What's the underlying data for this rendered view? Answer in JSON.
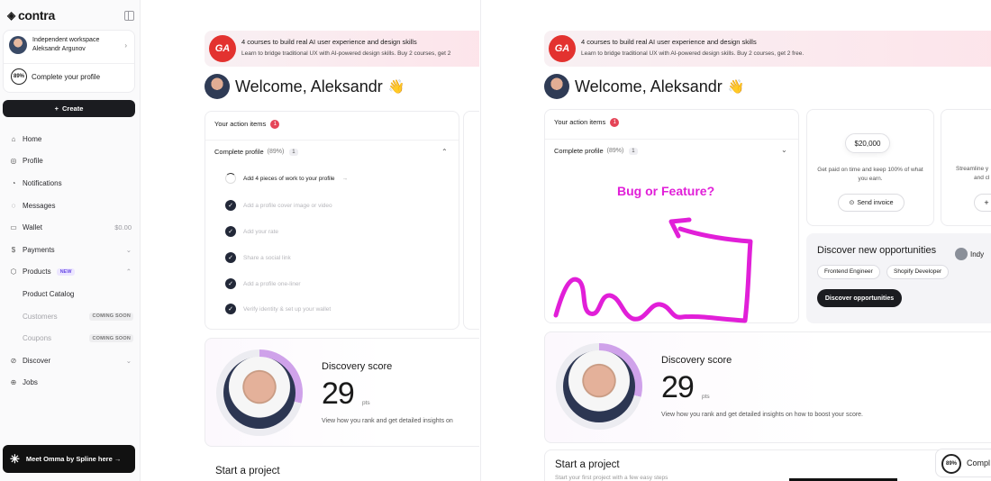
{
  "sidebar": {
    "logo": "contra",
    "workspace": {
      "title": "Independent workspace",
      "user": "Aleksandr Argunov"
    },
    "profile_percent": "89%",
    "complete_profile": "Complete your profile",
    "create_label": "Create",
    "nav": [
      {
        "label": "Home",
        "icon": "home-icon"
      },
      {
        "label": "Profile",
        "icon": "profile-icon"
      },
      {
        "label": "Notifications",
        "icon": "bell-icon"
      },
      {
        "label": "Messages",
        "icon": "messages-icon"
      },
      {
        "label": "Wallet",
        "icon": "wallet-icon",
        "value": "$0.00"
      },
      {
        "label": "Payments",
        "icon": "dollar-icon"
      },
      {
        "label": "Products",
        "icon": "products-icon",
        "badge": "NEW"
      },
      {
        "label": "Product Catalog"
      },
      {
        "label": "Customers",
        "badge": "COMING SOON"
      },
      {
        "label": "Coupons",
        "badge": "COMING SOON"
      },
      {
        "label": "Discover",
        "icon": "compass-icon"
      },
      {
        "label": "Jobs",
        "icon": "jobs-icon"
      }
    ],
    "omma_label": "Meet Omma by Spline here →"
  },
  "promo": {
    "title": "4 courses to build real AI user experience and design skills",
    "subtitle_left": "Learn to bridge traditional UX with AI-powered design skills. Buy 2 courses, get 2",
    "subtitle": "Learn to bridge traditional UX with AI-powered design skills. Buy 2 courses, get 2 free.",
    "logo_text": "GA"
  },
  "welcome": "Welcome, Aleksandr",
  "action_items": {
    "title": "Your action items",
    "count": "1",
    "complete_profile": "Complete profile",
    "percent": "(89%)",
    "pill": "1",
    "tasks": [
      "Add 4 pieces of work to your profile",
      "Add a profile cover image or video",
      "Add your rate",
      "Share a social link",
      "Add a profile one-liner",
      "Verify identity & set up your wallet"
    ]
  },
  "discovery": {
    "title": "Discovery score",
    "score": "29",
    "unit": "pts",
    "desc_left": "View how you rank and get detailed insights on",
    "desc": "View how you rank and get detailed insights on how to boost your score."
  },
  "start": {
    "title": "Start a project",
    "subtitle": "Start your first project with a few easy steps"
  },
  "annotation": "Bug or Feature?",
  "invoice": {
    "amount": "$20,000",
    "text": "Get paid on time and keep 100% of what you earn.",
    "button": "Send invoice",
    "partial_text_1": "Streamline y",
    "partial_text_2": "and cl"
  },
  "opportunities": {
    "title": "Discover new opportunities",
    "tags": [
      "Frontend Engineer",
      "Shopify Developer"
    ],
    "button": "Discover opportunities",
    "indy": "Indy"
  },
  "bottom_badge": {
    "percent": "89%",
    "label": "Compl"
  }
}
